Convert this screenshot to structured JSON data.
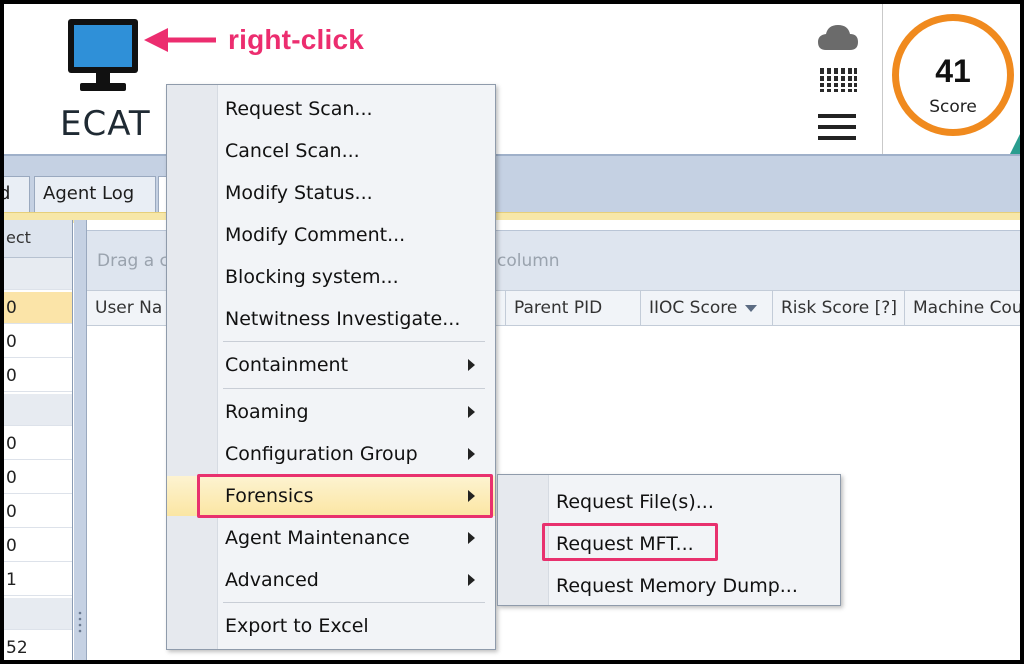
{
  "annotation": {
    "text": "right-click",
    "color": "#ec2d6f"
  },
  "app": {
    "name": "ECAT"
  },
  "header_icons": [
    "cloud-icon",
    "grid-icon",
    "menu-icon"
  ],
  "score": {
    "value": "41",
    "label": "Score",
    "ring_color": "#f08a1e"
  },
  "tabs": {
    "partial_label": "d",
    "agent_log": "Agent Log"
  },
  "left_panel": {
    "header": "ect",
    "rows": [
      {
        "text": "",
        "type": "group"
      },
      {
        "text": "0",
        "type": "sel"
      },
      {
        "text": "0",
        "type": "row"
      },
      {
        "text": "0",
        "type": "row"
      },
      {
        "text": "",
        "type": "group"
      },
      {
        "text": "0",
        "type": "row"
      },
      {
        "text": "0",
        "type": "row"
      },
      {
        "text": "0",
        "type": "row"
      },
      {
        "text": "0",
        "type": "row"
      },
      {
        "text": "1",
        "type": "row"
      },
      {
        "text": "",
        "type": "group"
      },
      {
        "text": "52",
        "type": "row"
      }
    ]
  },
  "grid": {
    "group_hint_left": "Drag a c",
    "group_hint_right": "column",
    "columns": [
      "User Na",
      "Parent PID",
      "IIOC Score",
      "Risk Score [?]",
      "Machine Cou"
    ]
  },
  "context_menu": {
    "items": [
      {
        "label": "Request Scan...",
        "submenu": false
      },
      {
        "label": "Cancel Scan...",
        "submenu": false
      },
      {
        "label": "Modify Status...",
        "submenu": false
      },
      {
        "label": "Modify Comment...",
        "submenu": false
      },
      {
        "label": "Blocking system...",
        "submenu": false
      },
      {
        "label": "Netwitness Investigate...",
        "submenu": false
      },
      {
        "label": "Containment",
        "submenu": true
      },
      {
        "label": "Roaming",
        "submenu": true
      },
      {
        "label": "Configuration Group",
        "submenu": true
      },
      {
        "label": "Forensics",
        "submenu": true
      },
      {
        "label": "Agent Maintenance",
        "submenu": true
      },
      {
        "label": "Advanced",
        "submenu": true
      },
      {
        "label": "Export to Excel",
        "submenu": false
      }
    ]
  },
  "forensics_submenu": {
    "items": [
      "Request File(s)...",
      "Request MFT...",
      "Request Memory Dump..."
    ]
  },
  "highlight_color": "#e8316e"
}
